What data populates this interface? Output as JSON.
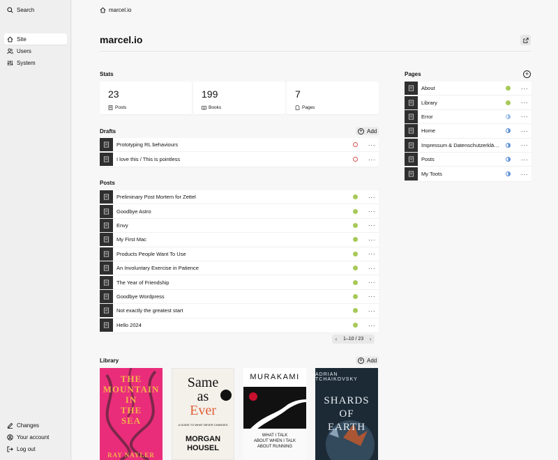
{
  "sidebar": {
    "search": "Search",
    "nav": [
      {
        "label": "Site",
        "icon": "home-icon",
        "active": true
      },
      {
        "label": "Users",
        "icon": "users-icon"
      },
      {
        "label": "System",
        "icon": "sliders-icon"
      }
    ],
    "bottom": [
      {
        "label": "Changes",
        "icon": "pencil-icon"
      },
      {
        "label": "Your account",
        "icon": "user-circle-icon"
      },
      {
        "label": "Log out",
        "icon": "logout-icon"
      }
    ]
  },
  "header": {
    "breadcrumb": "marcel.io",
    "title": "marcel.io"
  },
  "stats": {
    "label": "Stats",
    "items": [
      {
        "value": "23",
        "label": "Posts"
      },
      {
        "value": "199",
        "label": "Books"
      },
      {
        "value": "7",
        "label": "Pages"
      }
    ]
  },
  "drafts": {
    "label": "Drafts",
    "add": "Add",
    "items": [
      "Prototyping RL behaviours",
      "I love this / This is pointless"
    ]
  },
  "posts": {
    "label": "Posts",
    "items": [
      "Preliminary Post Mortem for Zettel",
      "Goodbye Astro",
      "Envy",
      "My First Mac",
      "Products People Want To Use",
      "An Involuntary Exercise in Patience",
      "The Year of Friendship",
      "Goodbye Wordpress",
      "Not exactly the greatest start",
      "Hello 2024"
    ],
    "pagination": "1–10 / 23"
  },
  "pages": {
    "label": "Pages",
    "items": [
      {
        "title": "About",
        "status": "published"
      },
      {
        "title": "Library",
        "status": "published"
      },
      {
        "title": "Error",
        "status": "unlisted-light"
      },
      {
        "title": "Home",
        "status": "unlisted"
      },
      {
        "title": "Impressum & Datenschutzerklä…",
        "status": "unlisted"
      },
      {
        "title": "Posts",
        "status": "unlisted"
      },
      {
        "title": "My Toots",
        "status": "unlisted"
      }
    ]
  },
  "library": {
    "label": "Library",
    "add": "Add",
    "books": [
      {
        "lines": [
          "THE",
          "MOUNTAIN",
          "IN",
          "THE",
          "SEA"
        ],
        "author": "RAY NAYLER",
        "colors": {
          "bg": "#ea2d7b",
          "text": "#f3b34a"
        }
      },
      {
        "lines": [
          "Same",
          "as",
          "Ever"
        ],
        "subtitle": "A GUIDE TO WHAT NEVER CHANGES",
        "author": "MORGAN HOUSEL",
        "colors": {
          "bg": "#f4f1ea",
          "accent": "#e0603a"
        }
      },
      {
        "author": "MURAKAMI",
        "lines": [
          "WHAT I TALK",
          "ABOUT WHEN I TALK",
          "ABOUT RUNNING"
        ]
      },
      {
        "author": "ADRIAN TCHAIKOVSKY",
        "lines": [
          "SHARDS",
          "OF",
          "EARTH"
        ],
        "colors": {
          "bg": "#1c2a36"
        }
      }
    ]
  }
}
